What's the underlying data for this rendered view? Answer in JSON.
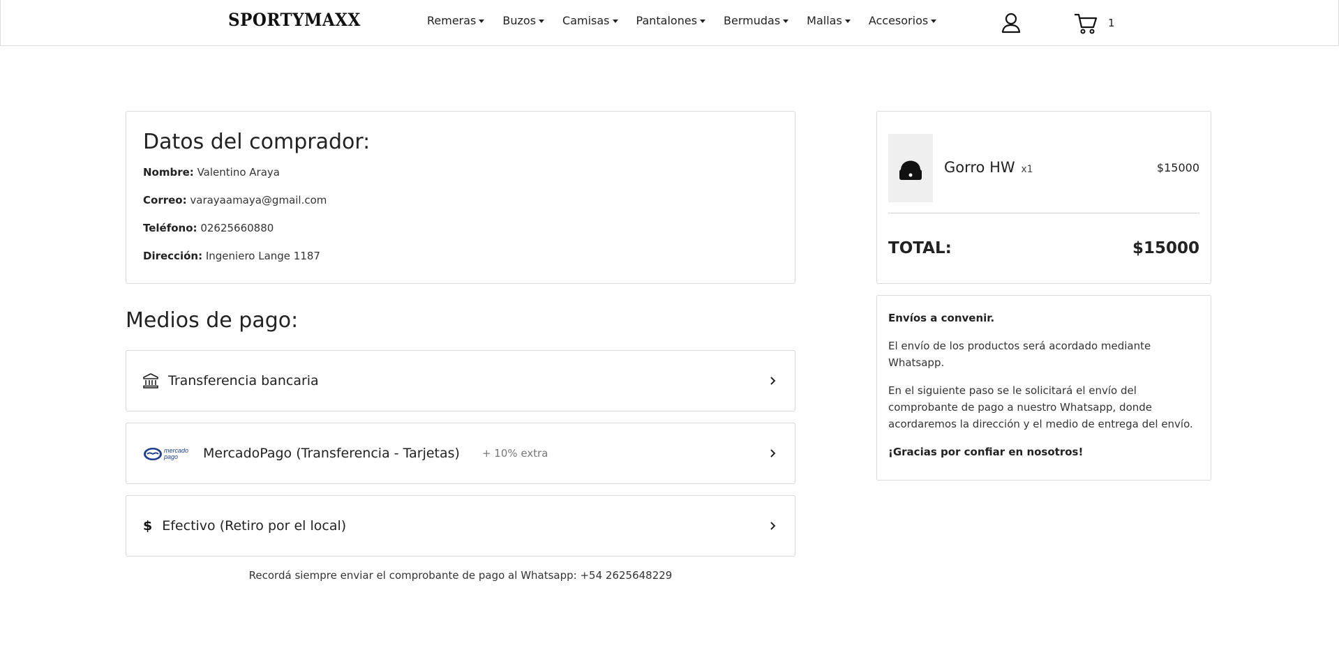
{
  "header": {
    "logo": "SPORTYMAXX",
    "nav": [
      "Remeras",
      "Buzos",
      "Camisas",
      "Pantalones",
      "Bermudas",
      "Mallas",
      "Accesorios"
    ],
    "cart_count": "1"
  },
  "buyer": {
    "title": "Datos del comprador:",
    "name_label": "Nombre:",
    "name": "Valentino Araya",
    "email_label": "Correo:",
    "email": "varayaamaya@gmail.com",
    "phone_label": "Teléfono:",
    "phone": "02625660880",
    "address_label": "Dirección:",
    "address": "Ingeniero Lange 1187"
  },
  "payment": {
    "title": "Medios de pago:",
    "options": [
      {
        "label": "Transferencia bancaria",
        "icon": "bank-icon"
      },
      {
        "label": "MercadoPago (Transferencia - Tarjetas)",
        "extra": "+ 10% extra",
        "icon": "mercadopago-logo",
        "logo_text_1": "mercado",
        "logo_text_2": "pago"
      },
      {
        "label": "Efectivo (Retiro por el local)",
        "icon": "dollar-icon",
        "symbol": "$"
      }
    ],
    "reminder": "Recordá siempre enviar el comprobante de pago al Whatsapp: +54 2625648229"
  },
  "summary": {
    "product_name": "Gorro HW",
    "product_qty": "x1",
    "product_price": "$15000",
    "total_label": "TOTAL:",
    "total_value": "$15000"
  },
  "shipping": {
    "title": "Envíos a convenir.",
    "p1": "El envío de los productos será acordado mediante Whatsapp.",
    "p2": "En el siguiente paso se le solicitará el envío del comprobante de pago a nuestro Whatsapp, donde acordaremos la dirección y el medio de entrega del envío.",
    "thanks": "¡Gracias por confiar en nosotros!"
  },
  "colors": {
    "border": "#d9d9d9",
    "text": "#222222",
    "mp_blue": "#1d3f8f",
    "product_bg": "#efefef"
  }
}
